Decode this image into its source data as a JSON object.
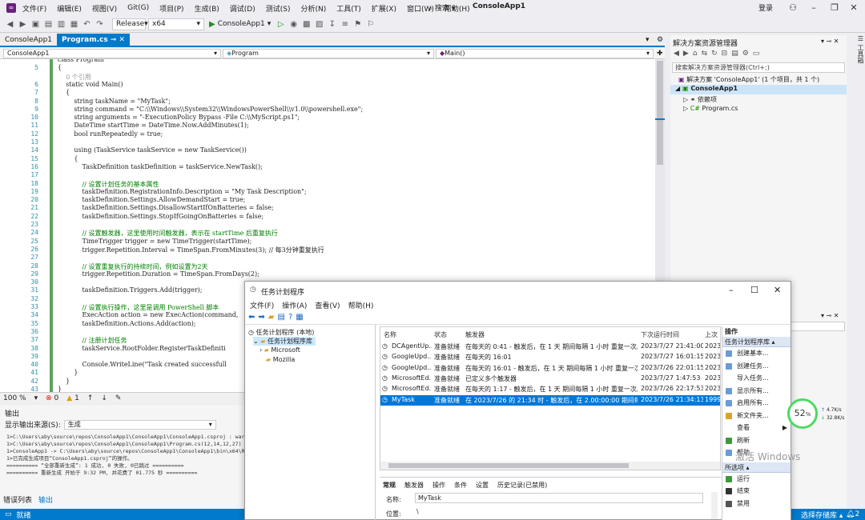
{
  "titlebar": {
    "menu": [
      "文件(F)",
      "编辑(E)",
      "视图(V)",
      "Git(G)",
      "项目(P)",
      "生成(B)",
      "调试(D)",
      "测试(S)",
      "分析(N)",
      "工具(T)",
      "扩展(X)",
      "窗口(W)",
      "帮助(H)"
    ],
    "search": "搜索",
    "app_title": "ConsoleApp1",
    "login": "登录"
  },
  "toolbar": {
    "config": "Release",
    "platform": "x64",
    "run_label": "ConsoleApp1"
  },
  "tabs": [
    "ConsoleApp1",
    "Program.cs"
  ],
  "navbar": {
    "project": "ConsoleApp1",
    "class": "Program",
    "member": "Main()"
  },
  "editor": {
    "lines": [
      {
        "n": "",
        "t": "class Program"
      },
      {
        "n": "5",
        "t": "{"
      },
      {
        "n": "",
        "t": "    0 个引用"
      },
      {
        "n": "6",
        "t": "    static void Main()"
      },
      {
        "n": "7",
        "t": "    {"
      },
      {
        "n": "8",
        "t": "        string taskName = \"MyTask\";"
      },
      {
        "n": "9",
        "t": "        string command = \"C:\\\\Windows\\\\System32\\\\WindowsPowerShell\\\\v1.0\\\\powershell.exe\";"
      },
      {
        "n": "10",
        "t": "        string arguments = \"-ExecutionPolicy Bypass -File C:\\\\MyScript.ps1\";"
      },
      {
        "n": "11",
        "t": "        DateTime startTime = DateTime.Now.AddMinutes(1);"
      },
      {
        "n": "12",
        "t": "        bool runRepeatedly = true;"
      },
      {
        "n": "13",
        "t": ""
      },
      {
        "n": "14",
        "t": "        using (TaskService taskService = new TaskService())"
      },
      {
        "n": "15",
        "t": "        {"
      },
      {
        "n": "16",
        "t": "            TaskDefinition taskDefinition = taskService.NewTask();"
      },
      {
        "n": "17",
        "t": ""
      },
      {
        "n": "18",
        "t": "            // 设置计划任务的基本属性"
      },
      {
        "n": "19",
        "t": "            taskDefinition.RegistrationInfo.Description = \"My Task Description\";"
      },
      {
        "n": "20",
        "t": "            taskDefinition.Settings.AllowDemandStart = true;"
      },
      {
        "n": "21",
        "t": "            taskDefinition.Settings.DisallowStartIfOnBatteries = false;"
      },
      {
        "n": "22",
        "t": "            taskDefinition.Settings.StopIfGoingOnBatteries = false;"
      },
      {
        "n": "23",
        "t": ""
      },
      {
        "n": "24",
        "t": "            // 设置触发器，这里使用时间触发器，表示在 startTime 后重复执行"
      },
      {
        "n": "25",
        "t": "            TimeTrigger trigger = new TimeTrigger(startTime);"
      },
      {
        "n": "26",
        "t": "            trigger.Repetition.Interval = TimeSpan.FromMinutes(3); // 每3分钟重复执行"
      },
      {
        "n": "27",
        "t": ""
      },
      {
        "n": "28",
        "t": "            // 设置重复执行的持续时间，例如设置为2天"
      },
      {
        "n": "29",
        "t": "            trigger.Repetition.Duration = TimeSpan.FromDays(2);"
      },
      {
        "n": "30",
        "t": ""
      },
      {
        "n": "31",
        "t": "            taskDefinition.Triggers.Add(trigger);"
      },
      {
        "n": "32",
        "t": ""
      },
      {
        "n": "33",
        "t": "            // 设置执行操作，这里是调用 PowerShell 脚本"
      },
      {
        "n": "34",
        "t": "            ExecAction action = new ExecAction(command,"
      },
      {
        "n": "35",
        "t": "            taskDefinition.Actions.Add(action);"
      },
      {
        "n": "36",
        "t": ""
      },
      {
        "n": "37",
        "t": "            // 注册计划任务"
      },
      {
        "n": "38",
        "t": "            taskService.RootFolder.RegisterTaskDefiniti"
      },
      {
        "n": "39",
        "t": ""
      },
      {
        "n": "40",
        "t": "            Console.WriteLine(\"Task created successfull"
      },
      {
        "n": "41",
        "t": "        }"
      },
      {
        "n": "42",
        "t": "    }"
      },
      {
        "n": "43",
        "t": "}"
      }
    ]
  },
  "editor_status": {
    "zoom": "100 %",
    "errors": "0",
    "warnings": "1"
  },
  "output": {
    "title": "输出",
    "source_label": "显示输出来源(S):",
    "source_value": "生成",
    "lines": [
      "1>C:\\Users\\aby\\source\\repos\\ConsoleApp1\\ConsoleApp1\\ConsoleApp1.csproj : war",
      "1>C:\\Users\\aby\\source\\repos\\ConsoleApp1\\ConsoleApp1\\Program.cs(12,14,12,27)",
      "1>ConsoleApp1 -> C:\\Users\\aby\\source\\repos\\ConsoleApp1\\ConsoleApp1\\bin\\x64\\R",
      "1>已完成生成项目“ConsoleApp1.csproj”的操作。",
      "========== “全部重新生成”: 1 成功, 0 失败, 0已跳过 ==========",
      "========== 重新生成 开始于 9:32 PM, 并花费了 01.775 秒 =========="
    ],
    "tabs": [
      "错误列表",
      "输出"
    ]
  },
  "solution": {
    "title": "解决方案资源管理器",
    "search": "搜索解决方案资源管理器(Ctrl+;)",
    "root": "解决方案 'ConsoleApp1' (1 个项目，共 1 个)",
    "project": "ConsoleApp1",
    "deps": "依赖项",
    "file": "Program.cs"
  },
  "statusbar": {
    "left": "就绪",
    "right": "选择存储库",
    "badge": "2"
  },
  "taskscheduler": {
    "title": "任务计划程序",
    "menu": [
      "文件(F)",
      "操作(A)",
      "查看(V)",
      "帮助(H)"
    ],
    "tree": {
      "root": "任务计划程序 (本地)",
      "library": "任务计划程序库",
      "children": [
        "Microsoft",
        "Mozilla"
      ]
    },
    "columns": [
      "名称",
      "状态",
      "触发器",
      "下次运行时间",
      "上次"
    ],
    "rows": [
      {
        "name": "DCAgentUp...",
        "status": "准备就绪",
        "trigger": "在每天的 0:41 - 触发后，在 1 天 期间每隔 1 小时 重复一次。",
        "next": "2023/7/27 21:41:00",
        "last": "2023"
      },
      {
        "name": "GoogleUpd...",
        "status": "准备就绪",
        "trigger": "在每天的 16:01",
        "next": "2023/7/27 16:01:15",
        "last": "2023"
      },
      {
        "name": "GoogleUpd...",
        "status": "准备就绪",
        "trigger": "在每天的 16:01 - 触发后，在 1 天 期间每隔 1 小时 重复一次。",
        "next": "2023/7/26 22:01:15",
        "last": "2023"
      },
      {
        "name": "MicrosoftEd...",
        "status": "准备就绪",
        "trigger": "已定义多个触发器",
        "next": "2023/7/27 1:47:53",
        "last": "2023"
      },
      {
        "name": "MicrosoftEd...",
        "status": "准备就绪",
        "trigger": "在每天的 1:17 - 触发后，在 1 天 期间每隔 1 小时 重复一次。",
        "next": "2023/7/26 22:17:53",
        "last": "2023"
      },
      {
        "name": "MyTask",
        "status": "准备就绪",
        "trigger": "在 2023/7/26 的 21:34 时 - 触发后，在 2.00:00:00 期间每...",
        "next": "2023/7/26 21:34:13",
        "last": "1999"
      }
    ],
    "detail_tabs": [
      "常规",
      "触发器",
      "操作",
      "条件",
      "设置",
      "历史记录(已禁用)"
    ],
    "detail": {
      "name_label": "名称:",
      "name_value": "MyTask",
      "location_label": "位置:",
      "location_value": "\\"
    },
    "actions_header": "操作",
    "actions_section": "任务计划程序库",
    "actions": [
      "创建基本...",
      "创建任务...",
      "导入任务...",
      "显示所有...",
      "启用所有...",
      "新文件夹...",
      "查看",
      "刷新",
      "帮助"
    ],
    "selected_header": "所选项",
    "selected_actions": [
      "运行",
      "结束",
      "禁用"
    ]
  },
  "net": {
    "percent": "52",
    "unit": "%",
    "up": "4.7K/s",
    "down": "32.8K/s"
  },
  "watermark": "激活 Windows"
}
